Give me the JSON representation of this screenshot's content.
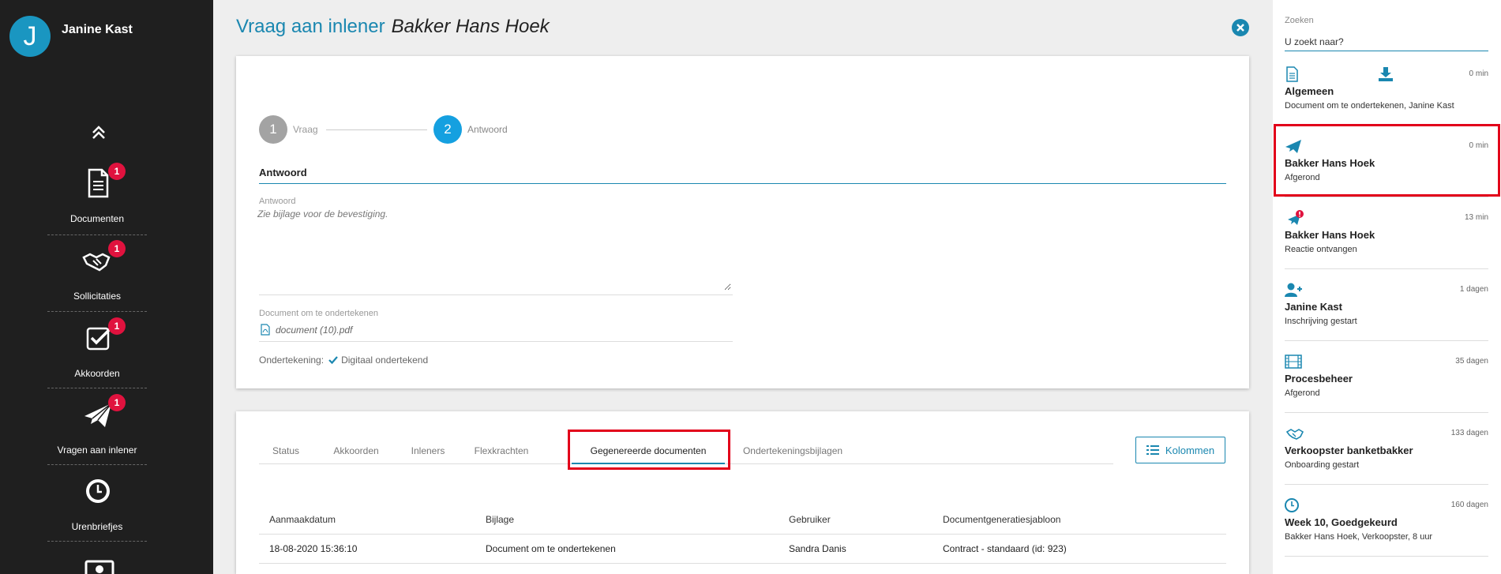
{
  "sidebar": {
    "user_initial": "J",
    "user_name": "Janine Kast",
    "items": [
      {
        "label": "Documenten",
        "badge": "1",
        "icon": "document-icon"
      },
      {
        "label": "Sollicitaties",
        "badge": "1",
        "icon": "handshake-icon"
      },
      {
        "label": "Akkoorden",
        "badge": "1",
        "icon": "checkbox-icon"
      },
      {
        "label": "Vragen aan inlener",
        "badge": "1",
        "icon": "paper-plane-icon"
      },
      {
        "label": "Urenbriefjes",
        "badge": "",
        "icon": "clock-icon"
      }
    ]
  },
  "header": {
    "title": "Vraag aan inlener",
    "subject": "Bakker Hans Hoek"
  },
  "wizard": {
    "steps": [
      {
        "number": "1",
        "label": "Vraag"
      },
      {
        "number": "2",
        "label": "Antwoord"
      }
    ]
  },
  "answer_section": {
    "title": "Antwoord",
    "answer_label": "Antwoord",
    "answer_value": "Zie bijlage voor de bevestiging.",
    "document_label": "Document om te ondertekenen",
    "document_name": "document (10).pdf",
    "signing_label": "Ondertekening:",
    "signing_value": "Digitaal ondertekend"
  },
  "tabs": [
    "Status",
    "Akkoorden",
    "Inleners",
    "Flexkrachten",
    "Gegenereerde documenten",
    "Ondertekeningsbijlagen"
  ],
  "active_tab": "Gegenereerde documenten",
  "columns_button": "Kolommen",
  "table": {
    "headers": [
      "Aanmaakdatum",
      "Bijlage",
      "Gebruiker",
      "Documentgeneratiesjabloon"
    ],
    "rows": [
      [
        "18-08-2020 15:36:10",
        "Document om te ondertekenen",
        "Sandra Danis",
        "Contract - standaard (id: 923)"
      ]
    ]
  },
  "search": {
    "label": "Zoeken",
    "placeholder": "U zoekt naar?"
  },
  "feed": [
    {
      "icon": "document-icon",
      "time": "0 min",
      "title": "Algemeen",
      "subtitle": "Document om te ondertekenen, Janine Kast"
    },
    {
      "icon": "paper-plane-icon",
      "time": "0 min",
      "title": "Bakker Hans Hoek",
      "subtitle": "Afgerond"
    },
    {
      "icon": "paper-plane-alert-icon",
      "time": "13 min",
      "title": "Bakker Hans Hoek",
      "subtitle": "Reactie ontvangen"
    },
    {
      "icon": "user-add-icon",
      "time": "1 dagen",
      "title": "Janine Kast",
      "subtitle": "Inschrijving gestart"
    },
    {
      "icon": "film-icon",
      "time": "35 dagen",
      "title": "Procesbeheer",
      "subtitle": "Afgerond"
    },
    {
      "icon": "handshake-icon",
      "time": "133 dagen",
      "title": "Verkoopster banketbakker",
      "subtitle": "Onboarding gestart"
    },
    {
      "icon": "clock-icon",
      "time": "160 dagen",
      "title": "Week 10, Goedgekeurd",
      "subtitle": "Bakker Hans Hoek, Verkoopster, 8 uur"
    }
  ],
  "colors": {
    "sidebar_bg": "#1f1f1f",
    "accent": "#1a87b0",
    "badge": "#e0123e",
    "highlight": "#e2001a"
  }
}
